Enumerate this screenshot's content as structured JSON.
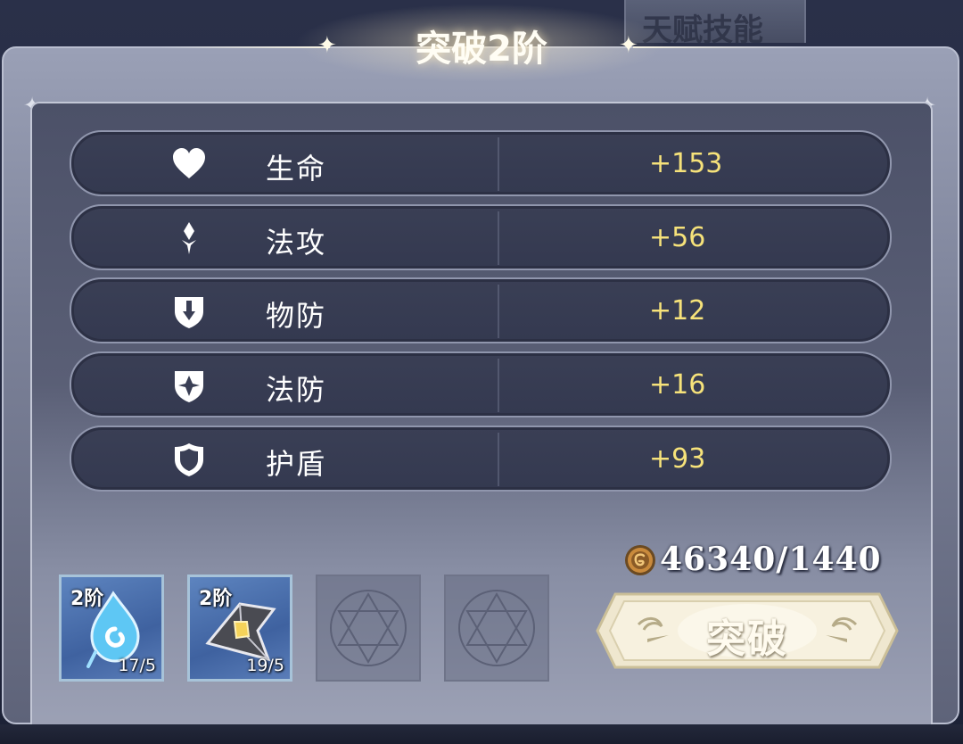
{
  "background_tab": {
    "label": "天赋技能"
  },
  "dialog": {
    "title": "突破2阶"
  },
  "stats": [
    {
      "icon": "heart-icon",
      "label": "生命",
      "value": "+153"
    },
    {
      "icon": "magic-attack-icon",
      "label": "法攻",
      "value": "+56"
    },
    {
      "icon": "physical-defense-icon",
      "label": "物防",
      "value": "+12"
    },
    {
      "icon": "magic-defense-icon",
      "label": "法防",
      "value": "+16"
    },
    {
      "icon": "shield-icon",
      "label": "护盾",
      "value": "+93"
    }
  ],
  "materials": [
    {
      "tier": "2阶",
      "count": "17/5",
      "icon": "blue-droplet-icon"
    },
    {
      "tier": "2阶",
      "count": "19/5",
      "icon": "crystal-shard-icon"
    },
    {
      "tier": "",
      "count": "",
      "icon": "hexagram-icon"
    },
    {
      "tier": "",
      "count": "",
      "icon": "hexagram-icon"
    }
  ],
  "cost": {
    "icon": "gold-coin-icon",
    "text": "46340/1440"
  },
  "break_button": {
    "label": "突破"
  },
  "colors": {
    "value_gold": "#f6e27a",
    "panel": "#7c8299",
    "row": "#3a3f55"
  }
}
